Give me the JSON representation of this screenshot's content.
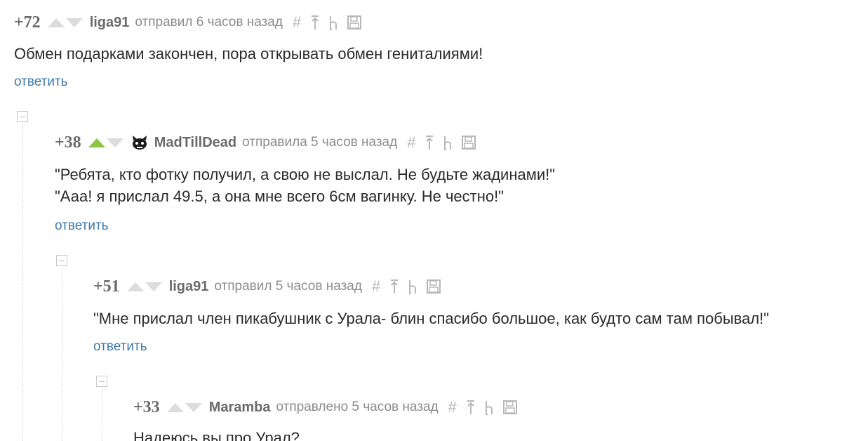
{
  "comments": [
    {
      "rating": "+72",
      "author": "liga91",
      "sent": "отправил 6 часов назад",
      "upvoted": false,
      "has_avatar": false,
      "body": [
        "Обмен подарками закончен, пора открывать обмен гениталиями!"
      ],
      "reply": "ответить"
    },
    {
      "rating": "+38",
      "author": "MadTillDead",
      "sent": "отправила 5 часов назад",
      "upvoted": true,
      "has_avatar": true,
      "body": [
        "\"Ребята, кто фотку получил, а свою не выслал. Не будьте жадинами!\"",
        "\"Ааа! я прислал 49.5, а она мне всего 6см вагинку. Не честно!\""
      ],
      "reply": "ответить"
    },
    {
      "rating": "+51",
      "author": "liga91",
      "sent": "отправил 5 часов назад",
      "upvoted": false,
      "has_avatar": false,
      "body": [
        "\"Мне прислал член пикабушник с Урала- блин спасибо большое, как будто сам там побывал!\""
      ],
      "reply": "ответить"
    },
    {
      "rating": "+33",
      "author": "Maramba",
      "sent": "отправлено 5 часов назад",
      "upvoted": false,
      "has_avatar": false,
      "body": [
        "Надеюсь вы про Урал?"
      ],
      "reply": ""
    }
  ],
  "icons": {
    "link": "hash-icon",
    "parent": "parent-arrow-icon",
    "branch": "branch-icon",
    "save": "save-icon"
  },
  "colors": {
    "upvote_active": "#8dc640",
    "vote_inactive": "#dcdcdc",
    "reply_link": "#3d7aac",
    "meta_text": "#8c8c8c"
  }
}
